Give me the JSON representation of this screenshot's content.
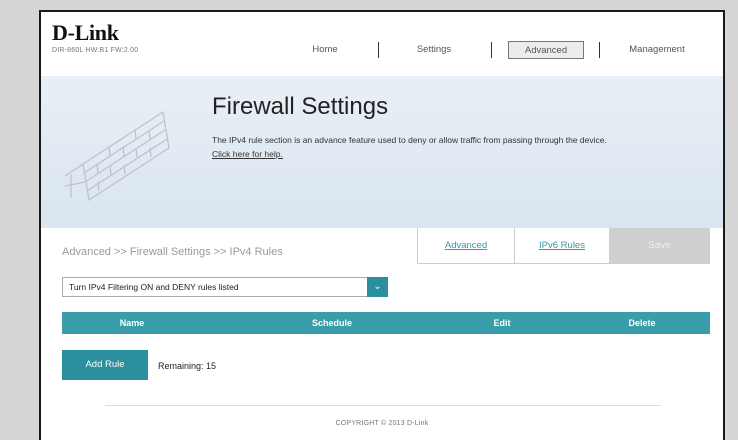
{
  "brand": {
    "logo": "D-Link",
    "model": "DIR-860L  HW:B1  FW:2.00"
  },
  "nav": {
    "items": [
      {
        "label": "Home"
      },
      {
        "label": "Settings"
      },
      {
        "label": "Advanced",
        "active": true
      },
      {
        "label": "Management"
      }
    ]
  },
  "banner": {
    "title": "Firewall Settings",
    "description": "The IPv4 rule section is an advance feature used to deny or allow traffic from passing through the device.",
    "help_link": "Click here for help."
  },
  "breadcrumb": "Advanced >> Firewall Settings >> IPv4 Rules",
  "tabs": {
    "advanced": "Advanced",
    "ipv6": "IPv6 Rules",
    "save": "Save"
  },
  "filter": {
    "selected": "Turn IPv4 Filtering ON and DENY rules listed"
  },
  "table": {
    "columns": [
      "Name",
      "Schedule",
      "Edit",
      "Delete"
    ]
  },
  "rules": {
    "add_label": "Add Rule",
    "remaining_label": "Remaining: 15"
  },
  "footer": {
    "copyright": "COPYRIGHT © 2013 D-Link"
  },
  "colors": {
    "accent": "#2b8f9f",
    "table_header": "#3a9eaa",
    "save_disabled": "#cfcfcf"
  }
}
